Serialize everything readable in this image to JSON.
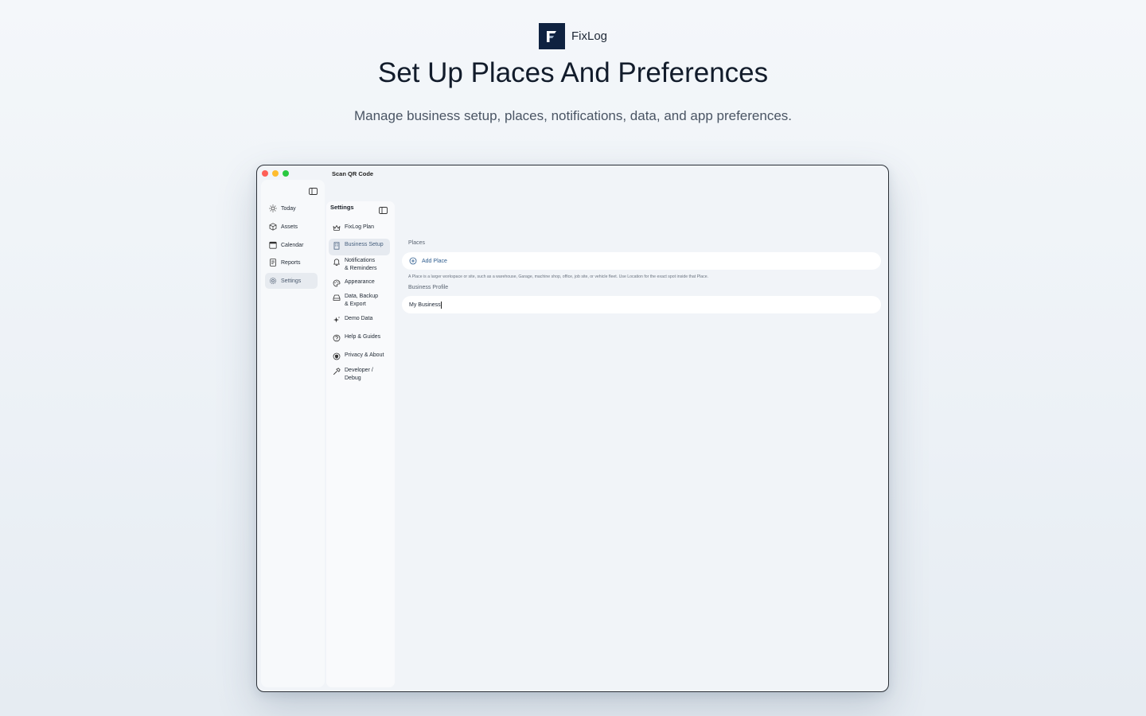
{
  "brand": {
    "name": "FixLog",
    "logo_color": "#0f2240"
  },
  "headline": "Set Up Places And Preferences",
  "subline": "Manage business setup, places, notifications, data, and app preferences.",
  "window": {
    "title": "Scan QR Code",
    "nav": [
      {
        "label": "Today",
        "icon": "sun-icon"
      },
      {
        "label": "Assets",
        "icon": "cube-icon"
      },
      {
        "label": "Calendar",
        "icon": "calendar-icon"
      },
      {
        "label": "Reports",
        "icon": "report-icon"
      },
      {
        "label": "Settings",
        "icon": "gear-icon",
        "active": true
      }
    ],
    "settings": {
      "title": "Settings",
      "items": [
        {
          "label": "FixLog Plan",
          "icon": "crown-icon"
        },
        {
          "label": "Business Setup",
          "icon": "building-icon",
          "active": true
        },
        {
          "label": "Notifications & Reminders",
          "line1": "Notifications",
          "line2": "& Reminders",
          "icon": "bell-icon"
        },
        {
          "label": "Appearance",
          "icon": "palette-icon"
        },
        {
          "label": "Data, Backup & Export",
          "line1": "Data, Backup",
          "line2": "& Export",
          "icon": "drive-icon"
        },
        {
          "label": "Demo Data",
          "icon": "sparkle-icon"
        },
        {
          "label": "Help & Guides",
          "icon": "question-icon"
        },
        {
          "label": "Privacy & About",
          "icon": "shield-icon"
        },
        {
          "label": "Developer / Debug",
          "line1": "Developer /",
          "line2": "Debug",
          "icon": "hammer-icon"
        }
      ]
    },
    "places": {
      "section_label": "Places",
      "add_label": "Add Place",
      "hint": "A Place is a larger workspace or site, such as a warehouse, Garage, machine shop, office, job site, or vehicle fleet. Use Location for the exact spot inside that Place."
    },
    "business_profile": {
      "section_label": "Business Profile",
      "name_value": "My Business"
    },
    "accent_color": "#2f5d8f"
  }
}
